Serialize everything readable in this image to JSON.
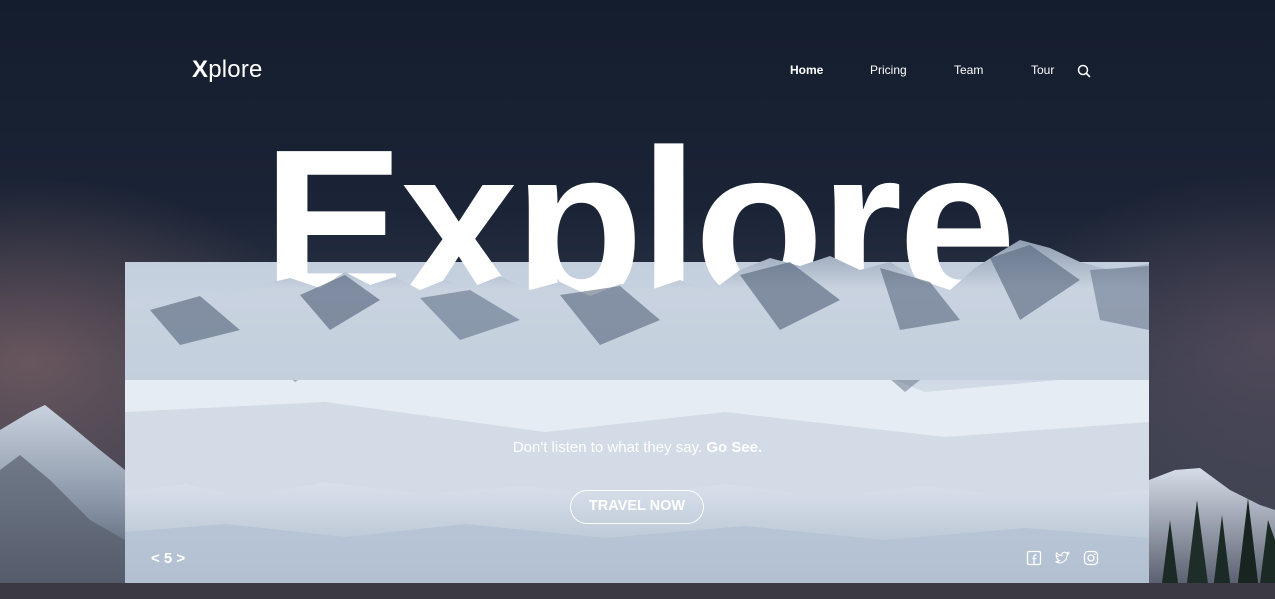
{
  "header": {
    "logo_first": "X",
    "logo_rest": "plore",
    "nav": [
      {
        "label": "Home",
        "active": true
      },
      {
        "label": "Pricing",
        "active": false
      },
      {
        "label": "Team",
        "active": false
      },
      {
        "label": "Tour",
        "active": false
      }
    ],
    "search_icon": "search-icon"
  },
  "hero": {
    "title": "Explore",
    "tagline_prefix": "Don't listen to what they say. ",
    "tagline_emphasis": "Go See.",
    "cta_label": "TRAVEL NOW"
  },
  "footer": {
    "pager": "< 5 >",
    "social_icons": [
      "facebook-icon",
      "twitter-icon",
      "instagram-icon"
    ]
  },
  "colors": {
    "sky": "#1b2436",
    "text": "#ffffff",
    "snow": "#dbe4ee"
  }
}
